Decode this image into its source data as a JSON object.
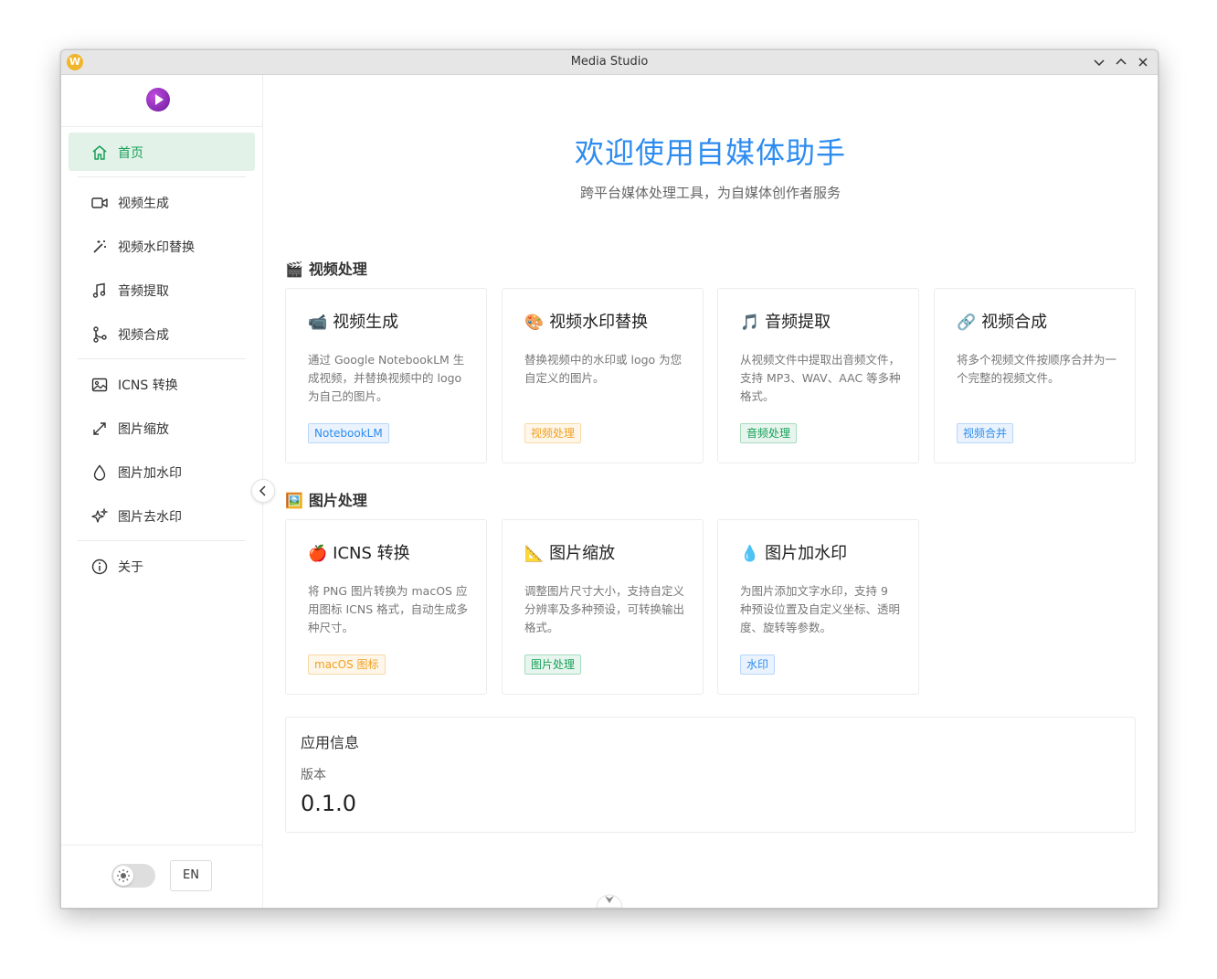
{
  "window": {
    "title": "Media Studio",
    "app_icon_letter": "W"
  },
  "sidebar": {
    "items": [
      {
        "label": "首页",
        "icon": "home-icon",
        "active": true
      },
      {
        "label": "视频生成",
        "icon": "video-camera-icon"
      },
      {
        "label": "视频水印替换",
        "icon": "magic-wand-icon"
      },
      {
        "label": "音频提取",
        "icon": "music-note-icon"
      },
      {
        "label": "视频合成",
        "icon": "merge-icon"
      },
      {
        "label": "ICNS 转换",
        "icon": "image-icon"
      },
      {
        "label": "图片缩放",
        "icon": "resize-icon"
      },
      {
        "label": "图片加水印",
        "icon": "droplet-icon"
      },
      {
        "label": "图片去水印",
        "icon": "sparkles-icon"
      },
      {
        "label": "关于",
        "icon": "info-icon"
      }
    ],
    "language_button": "EN",
    "theme_toggle": "sun-icon"
  },
  "hero": {
    "title": "欢迎使用自媒体助手",
    "subtitle": "跨平台媒体处理工具，为自媒体创作者服务"
  },
  "sections": [
    {
      "emoji": "🎬",
      "title": "视频处理",
      "cards": [
        {
          "emoji": "📹",
          "title": "视频生成",
          "desc": "通过 Google NotebookLM 生成视频，并替换视频中的 logo 为自己的图片。",
          "tag": "NotebookLM",
          "tag_color": "blue"
        },
        {
          "emoji": "🎨",
          "title": "视频水印替换",
          "desc": "替换视频中的水印或 logo 为您自定义的图片。",
          "tag": "视频处理",
          "tag_color": "orange"
        },
        {
          "emoji": "🎵",
          "title": "音频提取",
          "desc": "从视频文件中提取出音频文件，支持 MP3、WAV、AAC 等多种格式。",
          "tag": "音频处理",
          "tag_color": "green"
        },
        {
          "emoji": "🔗",
          "title": "视频合成",
          "desc": "将多个视频文件按顺序合并为一个完整的视频文件。",
          "tag": "视频合并",
          "tag_color": "blue"
        }
      ]
    },
    {
      "emoji": "🖼️",
      "title": "图片处理",
      "cards": [
        {
          "emoji": "🍎",
          "title": "ICNS 转换",
          "desc": "将 PNG 图片转换为 macOS 应用图标 ICNS 格式，自动生成多种尺寸。",
          "tag": "macOS 图标",
          "tag_color": "orange"
        },
        {
          "emoji": "📐",
          "title": "图片缩放",
          "desc": "调整图片尺寸大小，支持自定义分辨率及多种预设，可转换输出格式。",
          "tag": "图片处理",
          "tag_color": "green"
        },
        {
          "emoji": "💧",
          "title": "图片加水印",
          "desc": "为图片添加文字水印，支持 9 种预设位置及自定义坐标、透明度、旋转等参数。",
          "tag": "水印",
          "tag_color": "blue"
        }
      ]
    }
  ],
  "app_info": {
    "title": "应用信息",
    "version_label": "版本",
    "version": "0.1.0"
  },
  "colors": {
    "accent_green": "#18a058",
    "accent_blue": "#2d8cf0",
    "accent_orange": "#f0a020"
  }
}
